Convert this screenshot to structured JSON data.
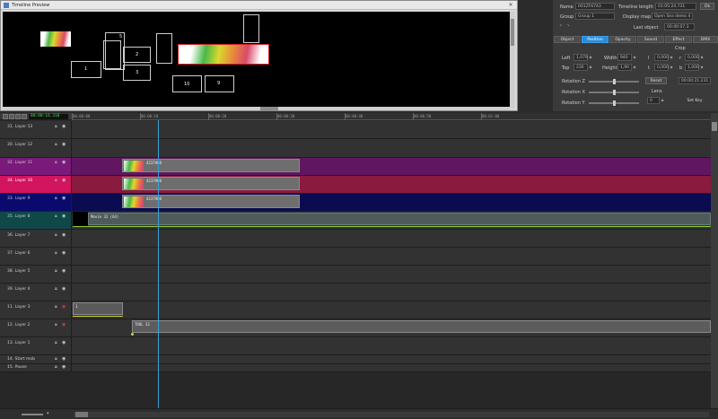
{
  "preview": {
    "title": "Timeline Preview",
    "close_glyph": "×",
    "boxes": [
      {
        "label": "1"
      },
      {
        "label": "2"
      },
      {
        "label": "3"
      },
      {
        "label": "5"
      },
      {
        "label": "10"
      },
      {
        "label": "9"
      }
    ]
  },
  "props": {
    "name_label": "Name",
    "name_value": "001ZF6743",
    "timeline_length_label": "Timeline length",
    "timeline_length_value": "01:05:24.731",
    "ok_label": "Ok",
    "group_label": "Group",
    "group_value": "Group 1",
    "display_map_label": "Display map",
    "display_map_value": "Open Sea demo 4",
    "last_object_label": "Last object",
    "last_object_value": "00:40:07.3",
    "tabs": [
      "Object",
      "Position",
      "Opacity",
      "Sound",
      "Effect",
      "DMX"
    ],
    "crop_label": "Crop",
    "left_label": "Left",
    "left_value": "1,079",
    "top_label": "Top",
    "top_value": "230",
    "width_label": "Width",
    "width_value": "940",
    "height_label": "Height",
    "height_value": "1,90",
    "crop_l": "l",
    "crop_l_value": "0,000",
    "crop_r": "r",
    "crop_r_value": "0,000",
    "crop_t": "t",
    "crop_t_value": "0,000",
    "crop_b": "b",
    "crop_b_value": "1,000",
    "rotation_z_label": "Rotation Z",
    "rotation_x_label": "Rotation X",
    "rotation_y_label": "Rotation Y",
    "reset_label": "Reset",
    "lens_label": "Lens",
    "lens_value": "0",
    "key_time": "00:00:21.231",
    "set_key_label": "Set Key"
  },
  "toolbar": {
    "timecode": "00:00:16.318"
  },
  "ruler": {
    "labels": [
      "00:00:00",
      "00:00:10",
      "00:00:20",
      "00:00:30",
      "00:00:40",
      "00:00:50",
      "00:01:00"
    ]
  },
  "layers": [
    {
      "name": "31. Layer 13"
    },
    {
      "name": "30. Layer 12"
    },
    {
      "name": "32. Layer 11"
    },
    {
      "name": "34. Layer 10"
    },
    {
      "name": "33. Layer 9"
    },
    {
      "name": "35. Layer 8"
    },
    {
      "name": "36. Layer 7"
    },
    {
      "name": "37. Layer 6"
    },
    {
      "name": "38. Layer 5"
    },
    {
      "name": "39. Layer 4"
    },
    {
      "name": "11. Layer 3"
    },
    {
      "name": "12. Layer 2"
    },
    {
      "name": "13. Layer 1"
    },
    {
      "name": "14. Start mob"
    },
    {
      "name": "15. Pause"
    }
  ],
  "clips": {
    "l11_label": "4237908",
    "l10_label": "4237908",
    "l9_label": "4237908",
    "l8_label": "Movie 32 (64)",
    "l3_label": "1",
    "l2_label": "TOOL 32"
  },
  "colors": {
    "layer11": "#7a1a7a",
    "layer10": "#d3145e",
    "layer9": "#0a0a6e",
    "layer8": "#0f4848",
    "playhead": "#3aa0d8",
    "accent_tab": "#2f8ad6"
  }
}
